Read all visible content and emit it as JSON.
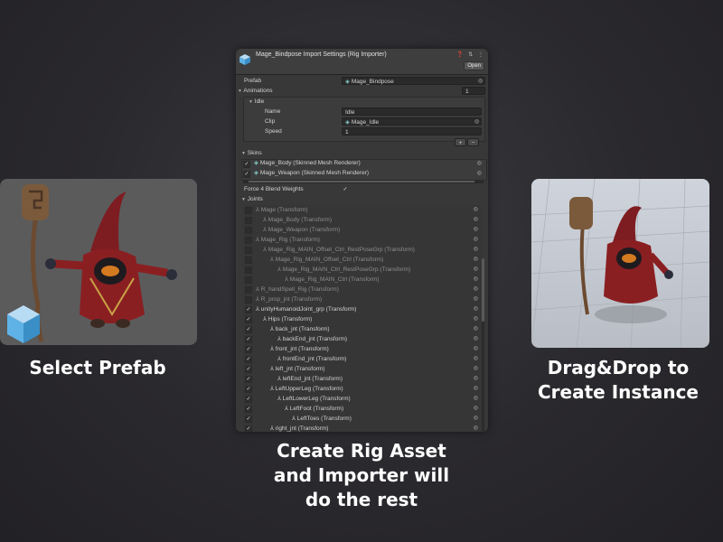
{
  "captions": {
    "left": "Select Prefab",
    "right_line1": "Drag&Drop to",
    "right_line2": "Create Instance",
    "center_line1": "Create Rig Asset",
    "center_line2": "and Importer will",
    "center_line3": "do the rest"
  },
  "inspector": {
    "title": "Mage_Bindpose Import Settings (Rig Importer)",
    "open_label": "Open",
    "header_icons": "❓ ⇅ ⋮",
    "prefab_label": "Prefab",
    "prefab_value": "Mage_Bindpose",
    "animations_label": "Animations",
    "animations_count": "1",
    "anim_item": "Idle",
    "name_label": "Name",
    "name_value": "Idle",
    "clip_label": "Clip",
    "clip_value": "Mage_Idle",
    "speed_label": "Speed",
    "speed_value": "1",
    "add_label": "+",
    "remove_label": "−",
    "skins_label": "Skins",
    "skins": [
      "Mage_Body (Skinned Mesh Renderer)",
      "Mage_Weapon (Skinned Mesh Renderer)"
    ],
    "force_label": "Force 4 Blend Weights",
    "joints_label": "Joints",
    "joints": [
      {
        "label": "Mage (Transform)",
        "checked": false,
        "indent": 0,
        "dim": true
      },
      {
        "label": "Mage_Body (Transform)",
        "checked": false,
        "indent": 1,
        "dim": true
      },
      {
        "label": "Mage_Weapon (Transform)",
        "checked": false,
        "indent": 1,
        "dim": true
      },
      {
        "label": "Mage_Rig (Transform)",
        "checked": false,
        "indent": 0,
        "dim": true
      },
      {
        "label": "Mage_Rig_MAIN_Offset_Ctrl_RestPoseGrp (Transform)",
        "checked": false,
        "indent": 1,
        "dim": true
      },
      {
        "label": "Mage_Rig_MAIN_Offset_Ctrl (Transform)",
        "checked": false,
        "indent": 2,
        "dim": true
      },
      {
        "label": "Mage_Rig_MAIN_Ctrl_RestPoseGrp (Transform)",
        "checked": false,
        "indent": 3,
        "dim": true
      },
      {
        "label": "Mage_Rig_MAIN_Ctrl (Transform)",
        "checked": false,
        "indent": 4,
        "dim": true
      },
      {
        "label": "R_handSpell_Rig (Transform)",
        "checked": false,
        "indent": 0,
        "dim": true
      },
      {
        "label": "R_prop_jnt (Transform)",
        "checked": false,
        "indent": 0,
        "dim": true
      },
      {
        "label": "unityHumanoidJoint_grp (Transform)",
        "checked": true,
        "indent": 0,
        "dim": false
      },
      {
        "label": "Hips (Transform)",
        "checked": true,
        "indent": 1,
        "dim": false
      },
      {
        "label": "back_jnt (Transform)",
        "checked": true,
        "indent": 2,
        "dim": false
      },
      {
        "label": "backEnd_jnt (Transform)",
        "checked": true,
        "indent": 3,
        "dim": false
      },
      {
        "label": "front_jnt (Transform)",
        "checked": true,
        "indent": 2,
        "dim": false
      },
      {
        "label": "frontEnd_jnt (Transform)",
        "checked": true,
        "indent": 3,
        "dim": false
      },
      {
        "label": "left_jnt (Transform)",
        "checked": true,
        "indent": 2,
        "dim": false
      },
      {
        "label": "leftEnd_jnt (Transform)",
        "checked": true,
        "indent": 3,
        "dim": false
      },
      {
        "label": "LeftUpperLeg (Transform)",
        "checked": true,
        "indent": 2,
        "dim": false
      },
      {
        "label": "LeftLowerLeg (Transform)",
        "checked": true,
        "indent": 3,
        "dim": false
      },
      {
        "label": "LeftFoot (Transform)",
        "checked": true,
        "indent": 4,
        "dim": false
      },
      {
        "label": "LeftToes (Transform)",
        "checked": true,
        "indent": 5,
        "dim": false
      },
      {
        "label": "right_jnt (Transform)",
        "checked": true,
        "indent": 2,
        "dim": false
      }
    ]
  },
  "colors": {
    "background": "#2a292d",
    "panel": "#383838",
    "field": "#2a2a2a",
    "robe_red": "#8a1f22",
    "unity_blue": "#4aa3e0"
  }
}
